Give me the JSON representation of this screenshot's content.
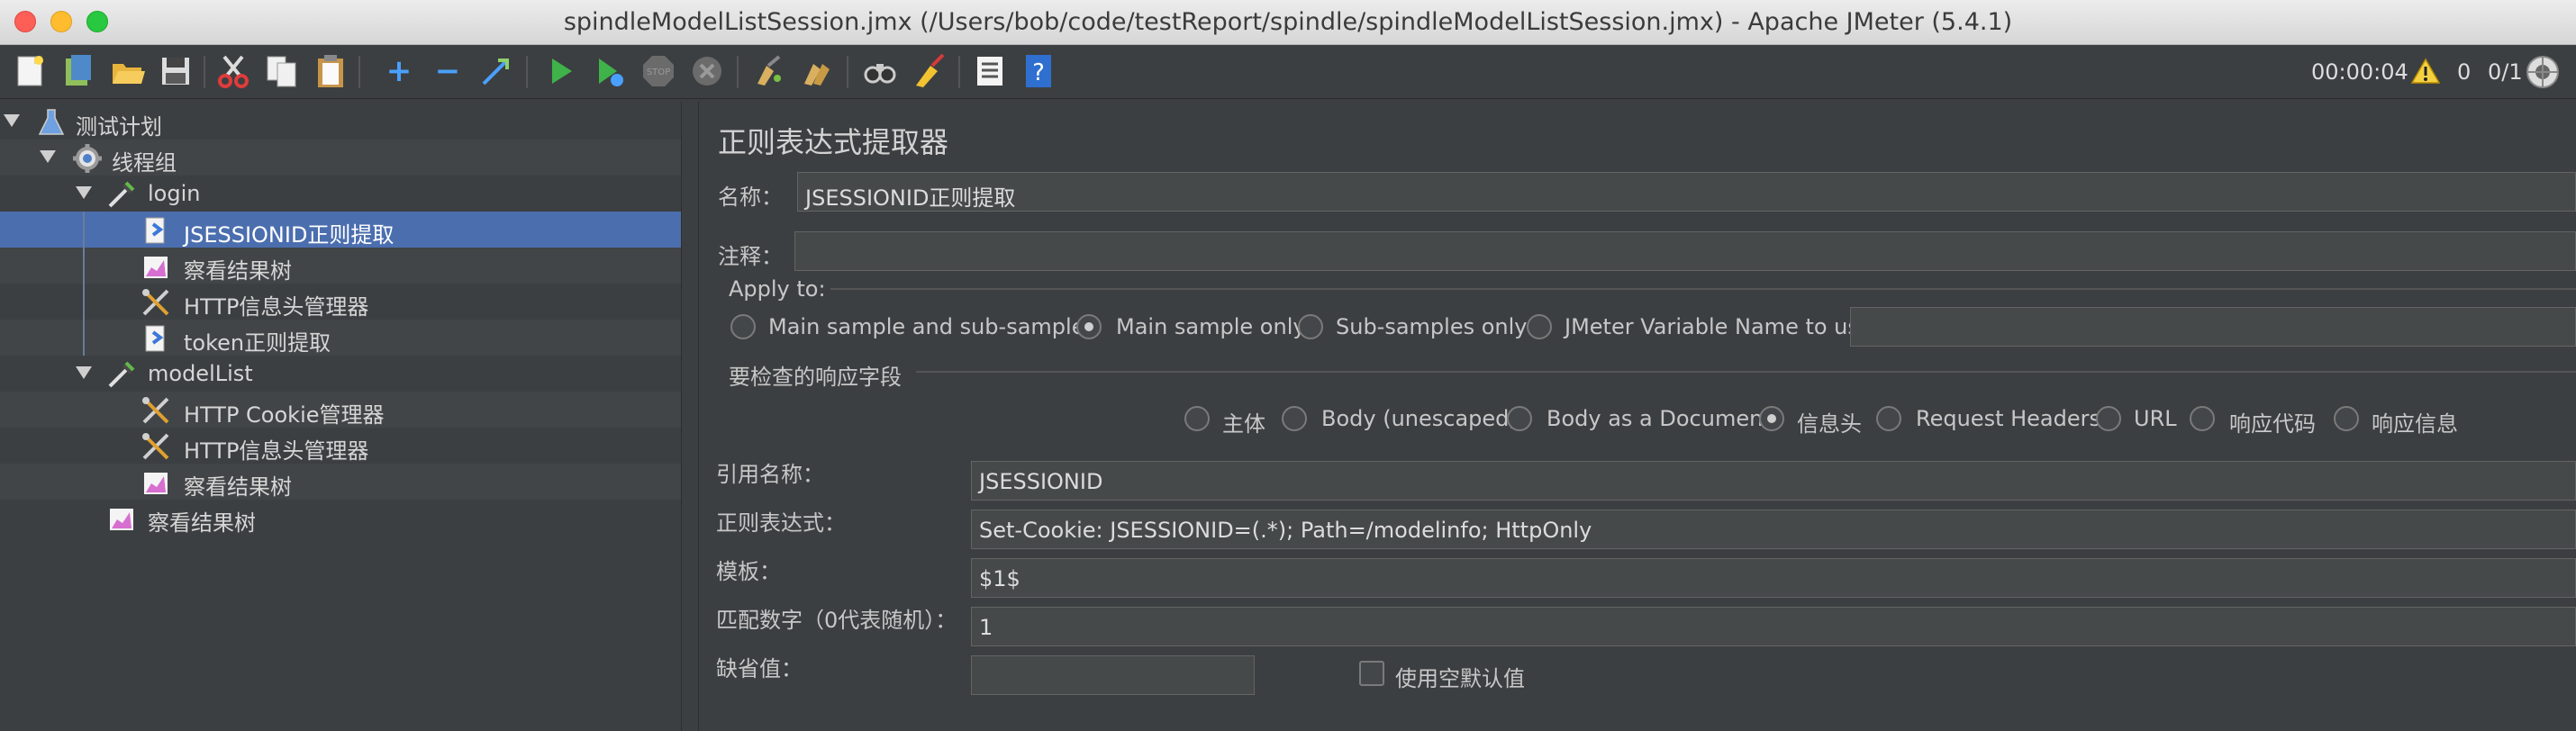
{
  "window": {
    "title": "spindleModelListSession.jmx (/Users/bob/code/testReport/spindle/spindleModelListSession.jmx) - Apache JMeter (5.4.1)"
  },
  "toolbar": {
    "timer": "00:00:04",
    "error_count": "0",
    "threads": "0/1",
    "buttons": [
      "new-icon",
      "templates-icon",
      "open-icon",
      "save-icon",
      "cut-icon",
      "copy-icon",
      "paste-icon",
      "expand-icon",
      "collapse-icon",
      "toggle-icon",
      "start-icon",
      "start-no-pause-icon",
      "stop-icon",
      "shutdown-icon",
      "clear-icon",
      "clear-all-icon",
      "search-icon",
      "reset-search-icon",
      "function-helper-icon",
      "help-icon"
    ]
  },
  "tree": {
    "items": [
      {
        "label": "测试计划"
      },
      {
        "label": "线程组"
      },
      {
        "label": "login"
      },
      {
        "label": "JSESSIONID正则提取"
      },
      {
        "label": "察看结果树"
      },
      {
        "label": "HTTP信息头管理器"
      },
      {
        "label": "token正则提取"
      },
      {
        "label": "modelList"
      },
      {
        "label": "HTTP Cookie管理器"
      },
      {
        "label": "HTTP信息头管理器"
      },
      {
        "label": "察看结果树"
      },
      {
        "label": "察看结果树"
      }
    ]
  },
  "panel": {
    "title": "正则表达式提取器",
    "name_label": "名称：",
    "name_value": "JSESSIONID正则提取",
    "comment_label": "注释：",
    "comment_value": "",
    "apply_to": {
      "label": "Apply to:",
      "options": [
        "Main sample and sub-samples",
        "Main sample only",
        "Sub-samples only",
        "JMeter Variable Name to use"
      ],
      "selected": "Main sample only",
      "variable_value": ""
    },
    "field_to_check": {
      "label": "要检查的响应字段",
      "options": [
        "主体",
        "Body (unescaped)",
        "Body as a Document",
        "信息头",
        "Request Headers",
        "URL",
        "响应代码",
        "响应信息"
      ],
      "selected": "信息头"
    },
    "ref_name_label": "引用名称：",
    "ref_name_value": "JSESSIONID",
    "regex_label": "正则表达式：",
    "regex_value": "Set-Cookie: JSESSIONID=(.*); Path=/modelinfo; HttpOnly",
    "template_label": "模板：",
    "template_value": "$1$",
    "match_no_label": "匹配数字（0代表随机）：",
    "match_no_value": "1",
    "default_label": "缺省值：",
    "default_value": "",
    "use_empty_default_label": "使用空默认值"
  }
}
